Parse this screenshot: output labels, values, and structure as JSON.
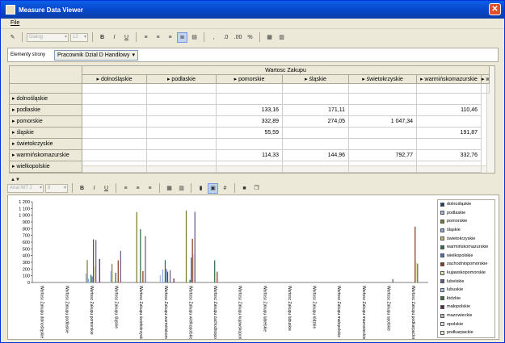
{
  "window": {
    "title": "Measure Data Viewer",
    "close_glyph": "✕"
  },
  "menu": {
    "file": "File"
  },
  "toolbar": {
    "font_name": "Dialog",
    "font_size": "12",
    "bold": "B",
    "italic": "I",
    "underline": "U",
    "chart_font_name": "Arial WT J",
    "chart_font_size": "8"
  },
  "filter": {
    "label": "Elementy strony",
    "value": "Pracownik Dzial D  Handlowy"
  },
  "grid": {
    "measure_header": "Wartosc Zakupu",
    "columns": [
      "dolnośląskie",
      "podlaskie",
      "pomorskie",
      "śląskie",
      "świetokrzyskie",
      "warmińskomazurskie",
      "w"
    ],
    "rows": [
      {
        "label": "dolnośląskie",
        "values": [
          "",
          "",
          "",
          "",
          "",
          ""
        ]
      },
      {
        "label": "podlaskie",
        "values": [
          "",
          "",
          "133,16",
          "171,11",
          "",
          "110,46"
        ]
      },
      {
        "label": "pomorskie",
        "values": [
          "",
          "",
          "332,89",
          "274,05",
          "1 047,34",
          ""
        ]
      },
      {
        "label": "śląskie",
        "values": [
          "",
          "",
          "55,59",
          "",
          "",
          "191,87"
        ]
      },
      {
        "label": "świetokrzyskie",
        "values": [
          "",
          "",
          "",
          "",
          "",
          ""
        ]
      },
      {
        "label": "warmińskomazurskie",
        "values": [
          "",
          "",
          "114,33",
          "144,96",
          "792,77",
          "332,76"
        ]
      },
      {
        "label": "wielkopolskie",
        "values": [
          "",
          "",
          "",
          "",
          "",
          ""
        ]
      }
    ]
  },
  "chart_data": {
    "type": "bar",
    "ylim": [
      0,
      1200
    ],
    "yticks": [
      "0",
      "100",
      "200",
      "300",
      "400",
      "500",
      "600",
      "700",
      "800",
      "900",
      "1 000",
      "1 100",
      "1 200"
    ],
    "categories": [
      "Wartosc Zakupu dolnośląskie",
      "Wartosc Zakupu podlaskie",
      "Wartosc Zakupu pomorskie",
      "Wartosc Zakupu śląskie",
      "Wartosc Zakupu świetokrzyskie",
      "Wartosc Zakupu warmińskomazurskie",
      "Wartosc Zakupu wielkopolskie",
      "Wartosc Zakupu zachodniopomorskie",
      "Wartosc Zakupu kujawskopomorskie",
      "Wartosc Zakupu lubelskie",
      "Wartosc Zakupu lubuskie",
      "Wartosc Zakupu łódzkie",
      "Wartosc Zakupu małopolskie",
      "Wartosc Zakupu mazowieckie",
      "Wartosc Zakupu opolskie",
      "Wartosc Zakupu podkarpackie"
    ],
    "series": [
      {
        "name": "dolnośląskie",
        "color": "#1f3f6f",
        "values": [
          0,
          0,
          0,
          0,
          0,
          0,
          0,
          0,
          0,
          0,
          0,
          0,
          0,
          0,
          0,
          0
        ]
      },
      {
        "name": "podlaskie",
        "color": "#9fb7e0",
        "values": [
          0,
          0,
          133,
          171,
          0,
          110,
          0,
          0,
          0,
          0,
          0,
          0,
          0,
          0,
          0,
          0
        ]
      },
      {
        "name": "pomorskie",
        "color": "#7a7a2a",
        "values": [
          0,
          0,
          333,
          274,
          1047,
          0,
          1070,
          0,
          0,
          0,
          0,
          0,
          0,
          0,
          0,
          0
        ]
      },
      {
        "name": "śląskie",
        "color": "#8aa7d6",
        "values": [
          0,
          0,
          56,
          0,
          0,
          192,
          0,
          0,
          0,
          0,
          0,
          0,
          0,
          0,
          0,
          0
        ]
      },
      {
        "name": "świetokrzyskie",
        "color": "#c8b46e",
        "values": [
          0,
          0,
          0,
          0,
          0,
          0,
          0,
          0,
          0,
          0,
          0,
          0,
          0,
          0,
          0,
          0
        ]
      },
      {
        "name": "warmińskomazurskie",
        "color": "#2e6b4f",
        "values": [
          0,
          0,
          114,
          145,
          793,
          333,
          40,
          330,
          0,
          0,
          0,
          0,
          0,
          0,
          0,
          0
        ]
      },
      {
        "name": "wielkopolskie",
        "color": "#4c6fb5",
        "values": [
          0,
          0,
          90,
          0,
          0,
          200,
          370,
          0,
          0,
          0,
          0,
          0,
          0,
          0,
          0,
          0
        ]
      },
      {
        "name": "zachodniopomorskie",
        "color": "#8a3a1a",
        "values": [
          0,
          0,
          640,
          330,
          170,
          160,
          650,
          160,
          0,
          0,
          0,
          0,
          0,
          0,
          0,
          830
        ]
      },
      {
        "name": "kujawskopomorskie",
        "color": "#e8e0a8",
        "values": [
          0,
          0,
          240,
          0,
          0,
          0,
          420,
          0,
          0,
          0,
          0,
          0,
          0,
          0,
          0,
          300
        ]
      },
      {
        "name": "lubelskie",
        "color": "#6a5a8a",
        "values": [
          0,
          0,
          630,
          470,
          690,
          180,
          1050,
          0,
          0,
          0,
          0,
          0,
          0,
          0,
          50,
          280
        ]
      },
      {
        "name": "lubuskie",
        "color": "#a8c8e8",
        "values": [
          0,
          0,
          0,
          0,
          0,
          0,
          0,
          0,
          0,
          0,
          0,
          0,
          0,
          0,
          0,
          0
        ]
      },
      {
        "name": "łódzkie",
        "color": "#3a6f3a",
        "values": [
          0,
          0,
          0,
          0,
          0,
          0,
          0,
          0,
          0,
          0,
          0,
          0,
          0,
          0,
          0,
          0
        ]
      },
      {
        "name": "małopolskie",
        "color": "#5a2a4a",
        "values": [
          0,
          0,
          350,
          0,
          0,
          60,
          0,
          0,
          0,
          0,
          0,
          0,
          0,
          0,
          0,
          0
        ]
      },
      {
        "name": "mazowieckie",
        "color": "#b8b8b8",
        "values": [
          0,
          0,
          0,
          0,
          0,
          0,
          0,
          0,
          0,
          0,
          0,
          0,
          0,
          0,
          0,
          0
        ]
      },
      {
        "name": "opolskie",
        "color": "#d8e0f0",
        "values": [
          0,
          0,
          0,
          0,
          0,
          0,
          0,
          0,
          0,
          0,
          0,
          0,
          0,
          0,
          0,
          0
        ]
      },
      {
        "name": "podkarpackie",
        "color": "#f0e8d0",
        "values": [
          0,
          0,
          0,
          0,
          0,
          0,
          0,
          0,
          0,
          0,
          0,
          0,
          0,
          0,
          0,
          0
        ]
      }
    ]
  }
}
